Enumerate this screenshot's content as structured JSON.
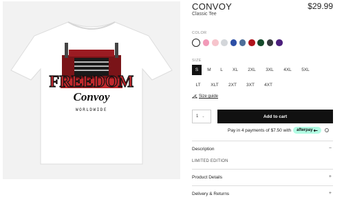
{
  "product": {
    "title": "CONVOY",
    "subtitle": "Classic Tee",
    "price": "$29.99",
    "image_alt": "Freedom Convoy t-shirt",
    "artwork": {
      "line1": "FREEDOM",
      "line2": "Convoy",
      "line3": "WORLDWIDE"
    }
  },
  "color": {
    "label": "COLOR",
    "swatches": [
      {
        "name": "white",
        "hex": "#ffffff",
        "selected": true
      },
      {
        "name": "pink",
        "hex": "#f29ab8",
        "selected": false
      },
      {
        "name": "light-pink",
        "hex": "#f6c4cc",
        "selected": false
      },
      {
        "name": "light-grey",
        "hex": "#d3d6da",
        "selected": false
      },
      {
        "name": "royal-blue",
        "hex": "#2d4fa6",
        "selected": false
      },
      {
        "name": "steel-blue",
        "hex": "#4e6e99",
        "selected": false
      },
      {
        "name": "red",
        "hex": "#b0141c",
        "selected": false
      },
      {
        "name": "forest-green",
        "hex": "#154a2b",
        "selected": false
      },
      {
        "name": "charcoal",
        "hex": "#36393d",
        "selected": false
      },
      {
        "name": "purple",
        "hex": "#4b1f7c",
        "selected": false
      }
    ]
  },
  "size": {
    "label": "SIZE",
    "options": [
      "S",
      "M",
      "L",
      "XL",
      "2XL",
      "3XL",
      "4XL",
      "5XL",
      "LT",
      "XLT",
      "2XT",
      "3XT",
      "4XT"
    ],
    "selected": "S",
    "guide_label": "Size guide"
  },
  "cart": {
    "quantity": "1",
    "add_label": "Add to cart"
  },
  "payment": {
    "text": "Pay in 4 payments of $7.50 with",
    "badge": "afterpay"
  },
  "accordion": {
    "description": {
      "title": "Description",
      "sign": "−",
      "body": "LIMITED EDITION"
    },
    "product_details": {
      "title": "Product Details",
      "sign": "+"
    },
    "delivery": {
      "title": "Delivery & Returns",
      "sign": "+"
    }
  },
  "icons": [
    "hanger-icon",
    "chevron-down-icon",
    "afterpay-arrow-icon",
    "info-icon",
    "minus-icon",
    "plus-icon"
  ],
  "colors": {
    "accent": "#111111",
    "afterpay": "#b2fce4",
    "artwork_red": "#c0282d"
  }
}
